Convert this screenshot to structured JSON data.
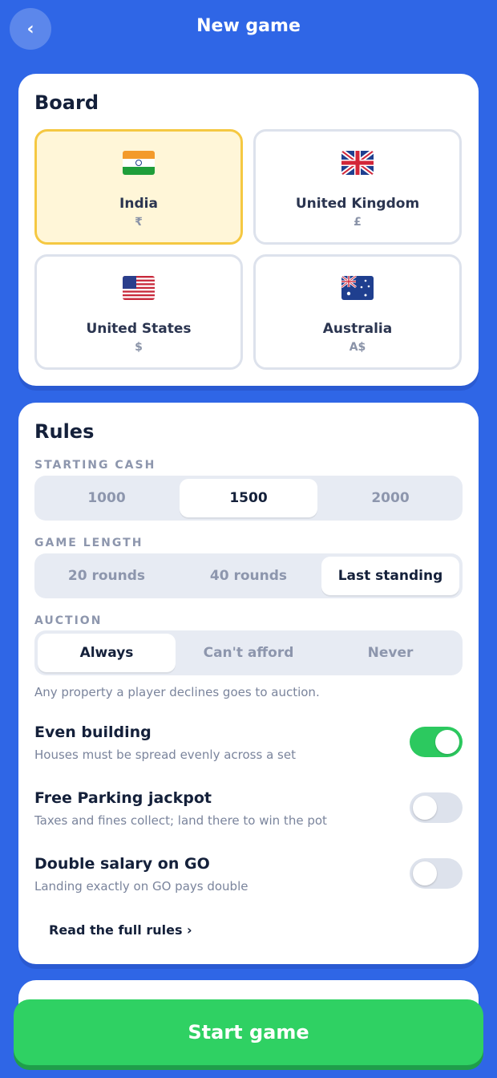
{
  "header": {
    "title": "New game",
    "back_icon": "chevron-left-icon"
  },
  "board": {
    "title": "Board",
    "options": [
      {
        "name": "India",
        "currency": "₹",
        "flag": "flag-india-icon",
        "selected": true
      },
      {
        "name": "United Kingdom",
        "currency": "£",
        "flag": "flag-uk-icon",
        "selected": false
      },
      {
        "name": "United States",
        "currency": "$",
        "flag": "flag-us-icon",
        "selected": false
      },
      {
        "name": "Australia",
        "currency": "A$",
        "flag": "flag-australia-icon",
        "selected": false
      }
    ]
  },
  "rules": {
    "title": "Rules",
    "starting_cash": {
      "label": "STARTING CASH",
      "options": [
        "1000",
        "1500",
        "2000"
      ],
      "selected": "1500"
    },
    "game_length": {
      "label": "GAME LENGTH",
      "options": [
        "20 rounds",
        "40 rounds",
        "Last standing"
      ],
      "selected": "Last standing"
    },
    "auction": {
      "label": "AUCTION",
      "options": [
        "Always",
        "Can't afford",
        "Never"
      ],
      "selected": "Always",
      "hint": "Any property a player declines goes to auction."
    },
    "toggles": [
      {
        "title": "Even building",
        "subtitle": "Houses must be spread evenly across a set",
        "on": true
      },
      {
        "title": "Free Parking jackpot",
        "subtitle": "Taxes and fines collect; land there to win the pot",
        "on": false
      },
      {
        "title": "Double salary on GO",
        "subtitle": "Landing exactly on GO pays double",
        "on": false
      }
    ],
    "full_rules_link": "Read the full rules ›"
  },
  "footer": {
    "start_label": "Start game"
  },
  "colors": {
    "background": "#2f66e6",
    "accent_green": "#2fd163",
    "selected_tile": "#fff6d8",
    "selected_border": "#f5c842"
  }
}
